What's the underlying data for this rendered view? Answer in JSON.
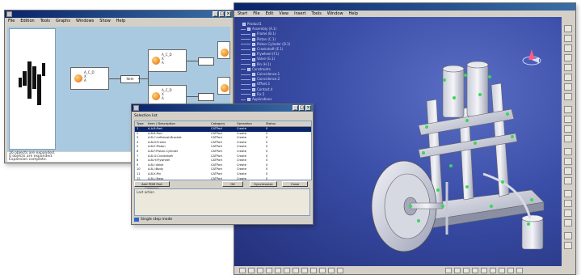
{
  "left_window": {
    "menu": [
      "File",
      "Edition",
      "Tools",
      "Graphs",
      "Windows",
      "Show",
      "Help"
    ],
    "status_lines": [
      "16 objects are expanded.",
      "0 objects are expanded.",
      "Expansion complete."
    ],
    "nodes": [
      {
        "text": "A_C_D\nX\nA"
      },
      {
        "text": "A_C_D\nX\nA"
      },
      {
        "text": "A_C_D\nX\nA"
      }
    ],
    "connector_label": "Item"
  },
  "dialog": {
    "section_label": "Selection list",
    "columns": [
      "Type",
      "Item / Description",
      "Category",
      "Operation",
      "Status"
    ],
    "rows": [
      [
        "1",
        "A-A-B:Part",
        "CATPart",
        "Create",
        "0"
      ],
      [
        "2",
        "A-B-B:Part",
        "CATPart",
        "Create",
        "0"
      ],
      [
        "3",
        "A-B-C:Leftmost-Bracket",
        "CATPart",
        "Create",
        "0"
      ],
      [
        "4",
        "A-B-D:Frame",
        "CATPart",
        "Create",
        "0"
      ],
      [
        "5",
        "A-B-E:Piston",
        "CATPart",
        "Create",
        "0"
      ],
      [
        "6",
        "A-B-F:Piston-Cylinder",
        "CATPart",
        "Create",
        "0"
      ],
      [
        "7",
        "A-B-G:Crankshaft",
        "CATPart",
        "Create",
        "0"
      ],
      [
        "8",
        "A-B-H:Flywheel",
        "CATPart",
        "Create",
        "0"
      ],
      [
        "9",
        "A-B-I:Valve",
        "CATPart",
        "Create",
        "0"
      ],
      [
        "10",
        "A-B-J:Body",
        "CATPart",
        "Create",
        "0"
      ],
      [
        "11",
        "A-B-K:Pin",
        "CATPart",
        "Create",
        "0"
      ],
      [
        "12",
        "A-B-L:Base",
        "CATPart",
        "Create",
        "0"
      ]
    ],
    "buttons": {
      "add": "Add PDM Part Category",
      "ok": "OK",
      "synchronize": "Synchronize",
      "close": "Close"
    },
    "log_label": "Last action",
    "status_text": "Single step mode"
  },
  "right_window": {
    "menu": [
      "Start",
      "File",
      "Edit",
      "View",
      "Insert",
      "Tools",
      "Window",
      "Help"
    ],
    "tree_items": [
      "Product1",
      "Assembly (A.1)",
      "Frame (B.1)",
      "Piston (C.1)",
      "Piston Cylinder (D.1)",
      "Crankshaft (E.1)",
      "Flywheel (F.1)",
      "Valve (G.1)",
      "Pin (H.1)",
      "Constraints",
      "Coincidence.1",
      "Coincidence.2",
      "Offset.3",
      "Contact.4",
      "Fix.5",
      "Applications"
    ]
  }
}
